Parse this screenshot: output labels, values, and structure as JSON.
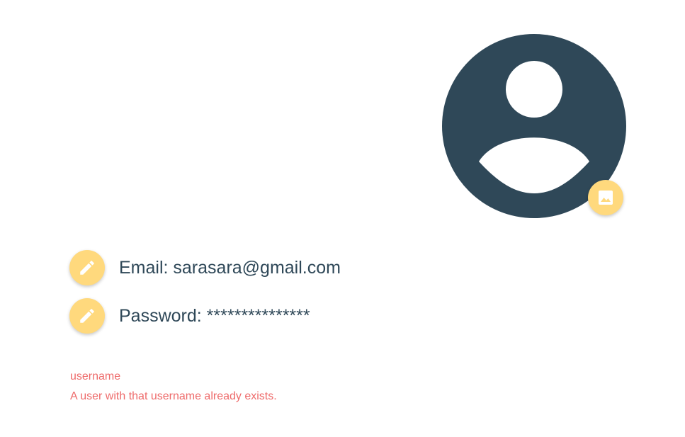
{
  "profile": {
    "email_label": "Email: ",
    "email_value": "sarasara@gmail.com",
    "password_label": "Password: ",
    "password_value": "***************"
  },
  "errors": {
    "field": "username",
    "message": "A user with that username already exists."
  },
  "icons": {
    "avatar": "user-avatar-placeholder",
    "change_photo": "image-icon",
    "edit": "pencil-icon"
  },
  "colors": {
    "avatar": "#2f4858",
    "accent": "#ffd97d",
    "text": "#2f4858",
    "error": "#ee6b6b"
  }
}
